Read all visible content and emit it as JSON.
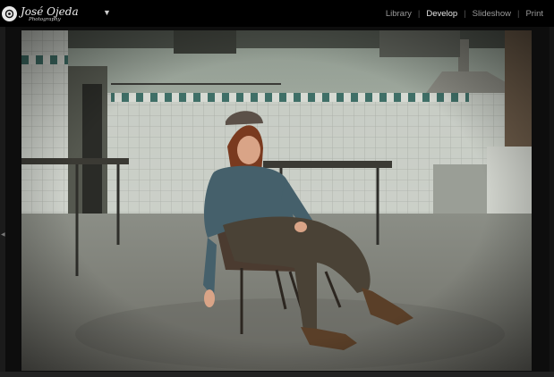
{
  "app": {
    "identity_plate": {
      "name": "José Ojeda",
      "subtitle": "Photography",
      "caret": "▼"
    },
    "modules": [
      {
        "label": "Library",
        "active": false
      },
      {
        "label": "Develop",
        "active": true
      },
      {
        "label": "Slideshow",
        "active": false
      },
      {
        "label": "Print",
        "active": false
      }
    ],
    "module_separator": "|"
  },
  "icons": {
    "left_panel_toggle": "triangle-left-icon",
    "logo": "camera-logo-icon"
  },
  "colors": {
    "topbar": "#000000",
    "active_module": "#e6e6e6",
    "inactive_module": "#9a9a9a",
    "background": "#0d0d0d"
  }
}
